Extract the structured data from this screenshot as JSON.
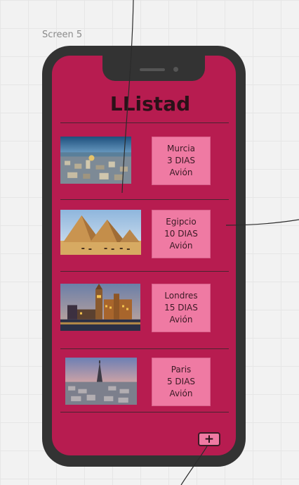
{
  "canvas": {
    "screen_label": "Screen 5"
  },
  "app": {
    "title": "LListad"
  },
  "destinations": [
    {
      "city": "Murcia",
      "duration": "3 DIAS",
      "transport": "Avión",
      "image": "murcia-city-photo"
    },
    {
      "city": "Egipcio",
      "duration": "10 DIAS",
      "transport": "Avión",
      "image": "pyramids-photo"
    },
    {
      "city": "Londres",
      "duration": "15 DIAS",
      "transport": "Avión",
      "image": "london-night-photo"
    },
    {
      "city": "Paris",
      "duration": "5 DIAS",
      "transport": "Avión",
      "image": "paris-eiffel-photo"
    }
  ],
  "actions": {
    "add_label": "+",
    "add_icon": "plus-icon"
  },
  "colors": {
    "screen_background": "#b71c50",
    "card_background": "#ef7aa3",
    "phone_frame": "#333333",
    "title_text": "#2a1118"
  }
}
